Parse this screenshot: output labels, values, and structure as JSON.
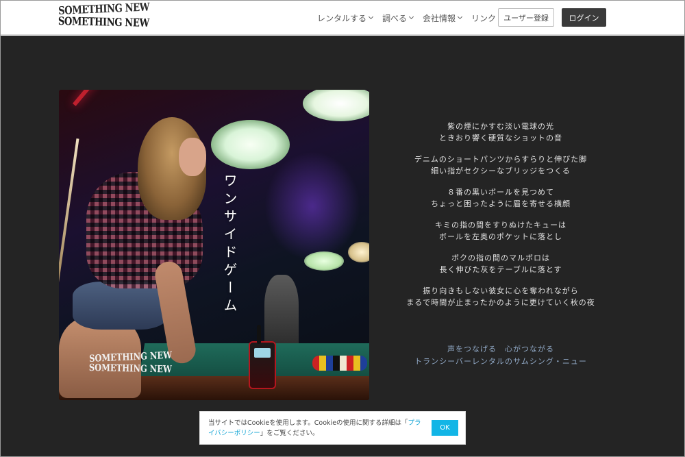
{
  "header": {
    "logo_line1": "SOMETHING NEW",
    "logo_line2": "SOMETHING NEW",
    "nav": [
      {
        "label": "レンタルする"
      },
      {
        "label": "調べる"
      },
      {
        "label": "会社情報"
      },
      {
        "label": "リンク"
      }
    ],
    "register_label": "ユーザー登録",
    "login_label": "ログイン"
  },
  "hero": {
    "title": "ワンサイドゲーム",
    "logo_line1": "SOMETHING NEW",
    "logo_line2": "SOMETHING NEW"
  },
  "poem": {
    "stanzas": [
      [
        "紫の煙にかすむ淡い電球の光",
        "ときおり響く硬質なショットの音"
      ],
      [
        "デニムのショートパンツからすらりと伸びた脚",
        "細い指がセクシーなブリッジをつくる"
      ],
      [
        "８番の黒いボールを見つめて",
        "ちょっと困ったように眉を寄せる横顔"
      ],
      [
        "キミの指の間をすりぬけたキューは",
        "ボールを左奥のポケットに落とし"
      ],
      [
        "ボクの指の間のマルボロは",
        "長く伸びた灰をテーブルに落とす"
      ],
      [
        "振り向きもしない彼女に心を奪われながら",
        "まるで時間が止まったかのように更けていく秋の夜"
      ]
    ]
  },
  "tagline": {
    "line1": "声をつなげる　心がつながる",
    "line2": "トランシーバーレンタルのサムシング・ニュー"
  },
  "cookie": {
    "text_before": "当サイトではCookieを使用します。Cookieの使用に関する詳細は「",
    "link": "プライバシーポリシー",
    "text_after": "」をご覧ください。",
    "ok_label": "OK"
  },
  "colors": {
    "accent": "#12b5e6",
    "background": "#242424",
    "tagline": "#8fa7c4"
  }
}
